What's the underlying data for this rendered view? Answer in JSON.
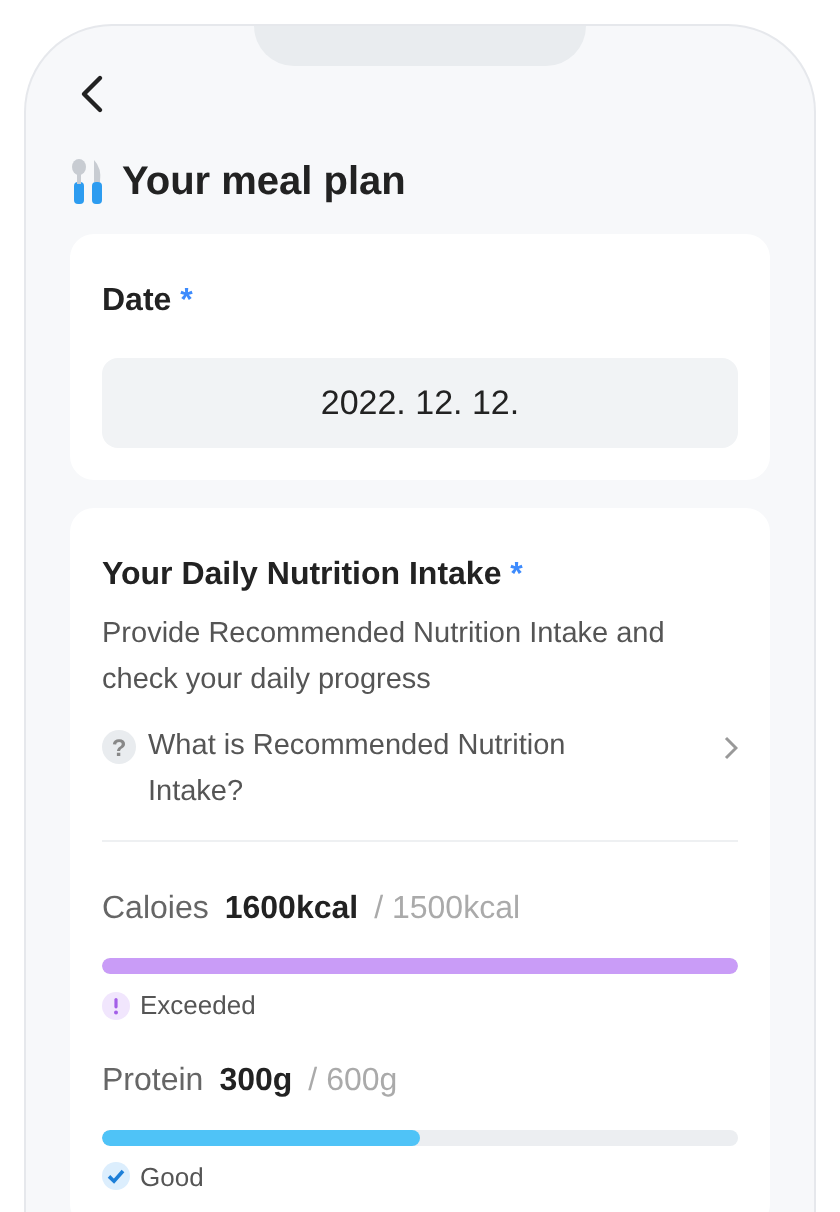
{
  "header": {
    "title": "Your meal plan"
  },
  "date_card": {
    "label": "Date",
    "required_mark": "*",
    "value": "2022. 12. 12."
  },
  "nutrition_card": {
    "title": "Your Daily Nutrition Intake",
    "required_mark": "*",
    "description": "Provide Recommended Nutrition Intake and check your daily progress",
    "help_icon": "?",
    "help_link": "What is Recommended Nutrition Intake?",
    "nutrients": [
      {
        "name": "Caloies",
        "amount": "1600kcal",
        "target": "/ 1500kcal",
        "level": 1,
        "color": "#c99cf7",
        "status": "Exceeded",
        "kind": "warning"
      },
      {
        "name": "Protein",
        "amount": "300g",
        "target": "/ 600g",
        "level": 0.5,
        "color": "#4fc3f7",
        "status": "Good",
        "kind": "good"
      }
    ]
  }
}
